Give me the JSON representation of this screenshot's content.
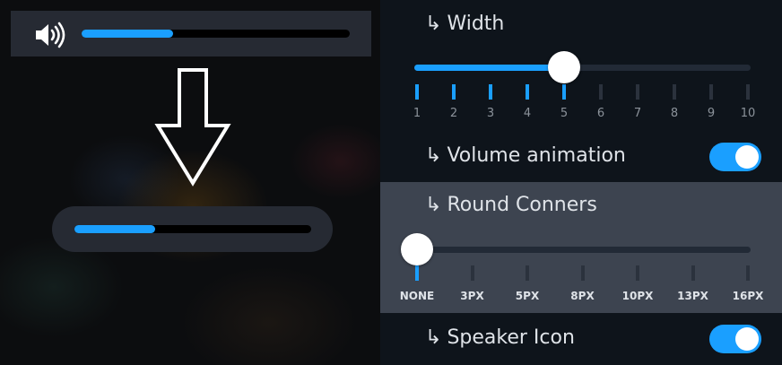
{
  "preview": {
    "speaker_icon": "speaker-volume-icon",
    "top_osd_level": 0.34,
    "arrow_icon": "down-arrow-outline-icon",
    "round_osd_level": 0.34
  },
  "settings": {
    "width": {
      "label": "Width",
      "prefix": "↳",
      "value": 5,
      "ticks": [
        "1",
        "2",
        "3",
        "4",
        "5",
        "6",
        "7",
        "8",
        "9",
        "10"
      ]
    },
    "volume_animation": {
      "label": "Volume animation",
      "prefix": "↳",
      "enabled": true
    },
    "round_corners": {
      "label": "Round Conners",
      "prefix": "↳",
      "value_index": 0,
      "ticks": [
        "NONE",
        "3PX",
        "5PX",
        "8PX",
        "10PX",
        "13PX",
        "16PX"
      ]
    },
    "speaker_icon": {
      "label": "Speaker Icon",
      "prefix": "↳",
      "enabled": true
    }
  },
  "colors": {
    "accent": "#1a9fff",
    "osd_bg": "#262a33",
    "panel_bg": "#0e141b",
    "highlight_row": "#3d4450"
  }
}
